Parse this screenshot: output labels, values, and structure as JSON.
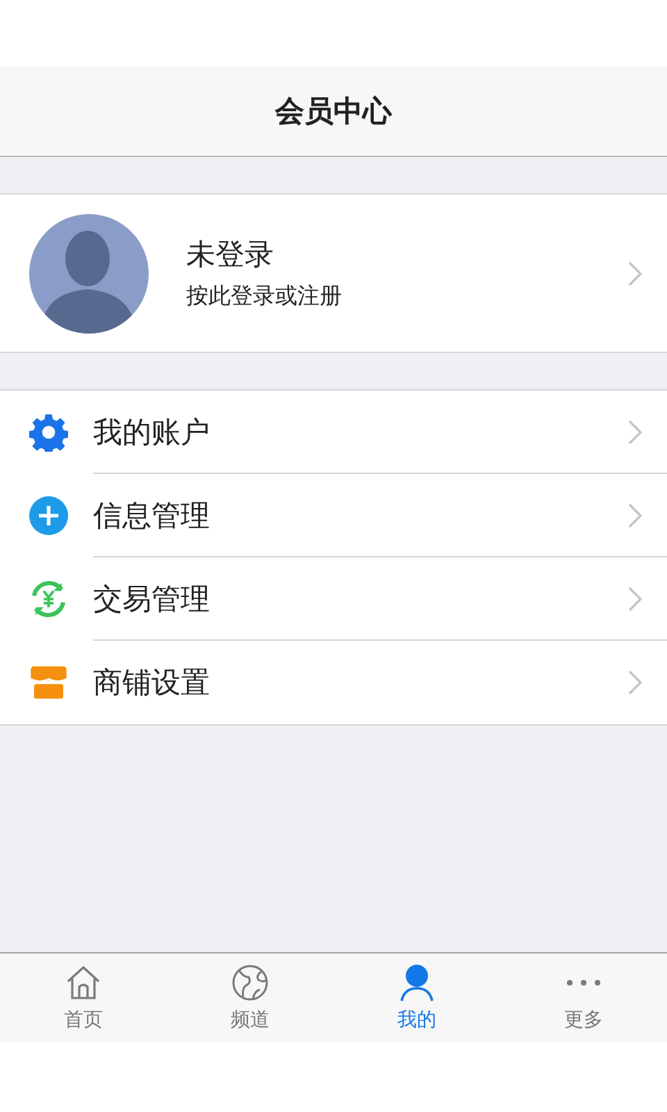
{
  "header": {
    "title": "会员中心"
  },
  "profile": {
    "name": "未登录",
    "hint": "按此登录或注册"
  },
  "menu": [
    {
      "kind": "gear",
      "label": "我的账户"
    },
    {
      "kind": "plus",
      "label": "信息管理"
    },
    {
      "kind": "yuan",
      "label": "交易管理"
    },
    {
      "kind": "shop",
      "label": "商铺设置"
    }
  ],
  "tabs": [
    {
      "kind": "home",
      "label": "首页",
      "selected": false
    },
    {
      "kind": "globe",
      "label": "频道",
      "selected": false
    },
    {
      "kind": "person",
      "label": "我的",
      "selected": true
    },
    {
      "kind": "more",
      "label": "更多",
      "selected": false
    }
  ]
}
